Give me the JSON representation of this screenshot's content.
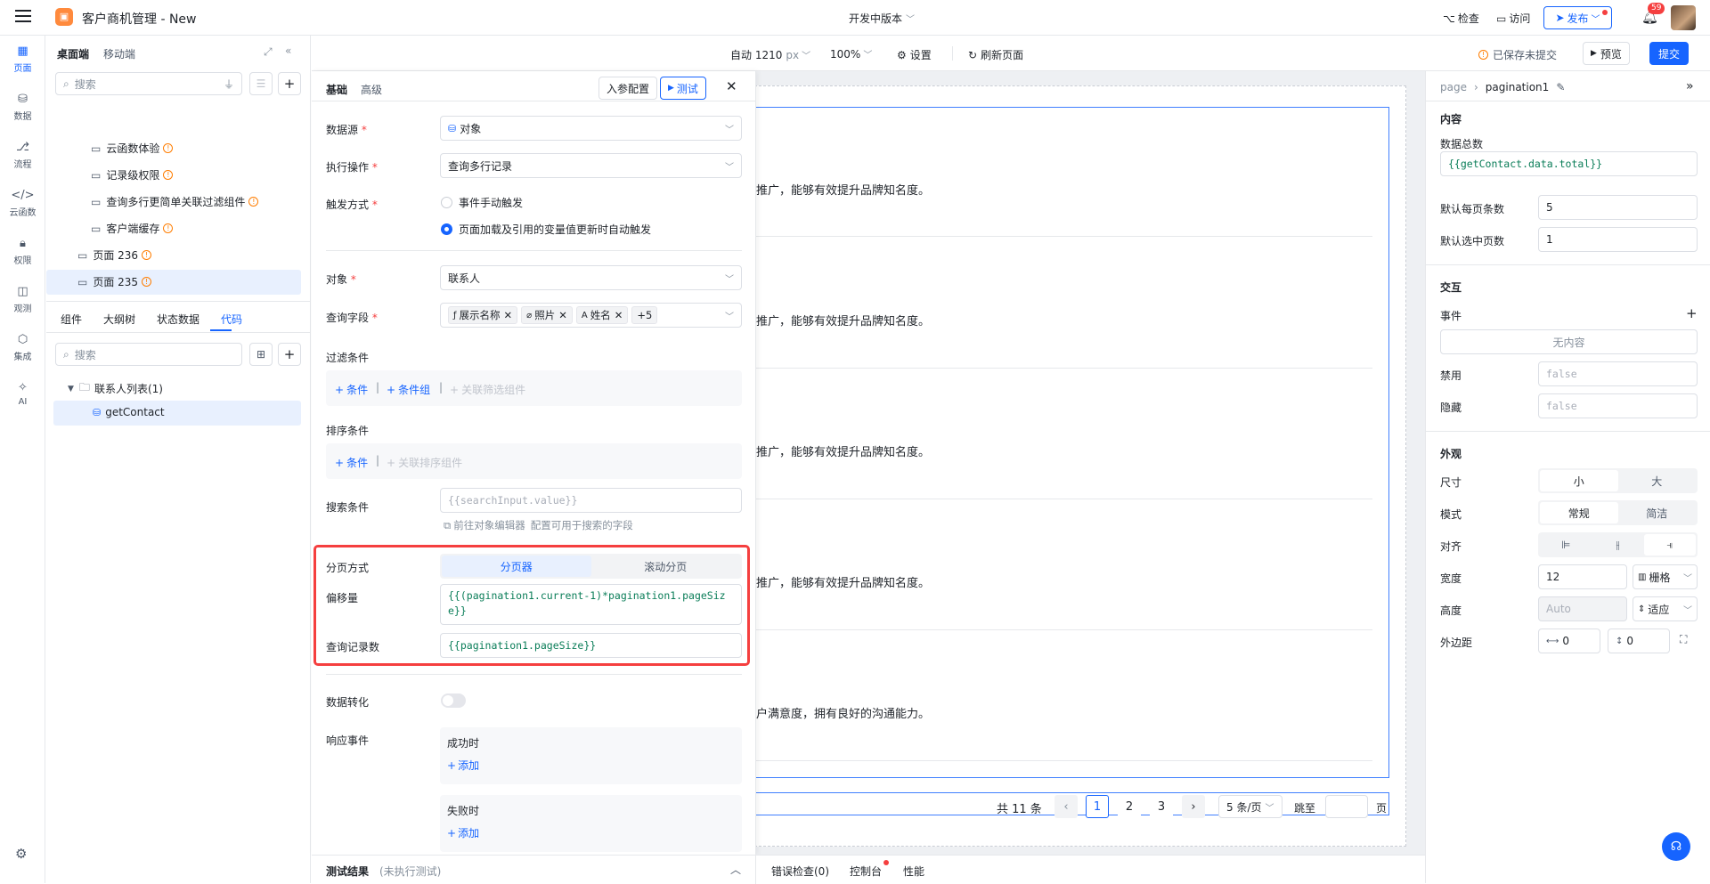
{
  "app": {
    "title": "客户商机管理 - New",
    "version": "开发中版本",
    "check": "检查",
    "visit": "访问",
    "publish": "发布",
    "notification_count": "59"
  },
  "rail": [
    {
      "label": "页面",
      "icon": "page-icon"
    },
    {
      "label": "数据",
      "icon": "database-icon"
    },
    {
      "label": "流程",
      "icon": "flow-icon"
    },
    {
      "label": "云函数",
      "icon": "code-icon"
    },
    {
      "label": "权限",
      "icon": "lock-icon"
    },
    {
      "label": "观测",
      "icon": "monitor-icon"
    },
    {
      "label": "集成",
      "icon": "integration-icon"
    },
    {
      "label": "AI",
      "icon": "ai-icon"
    }
  ],
  "tree": {
    "tabs": [
      "桌面端",
      "移动端"
    ],
    "search_placeholder": "搜索",
    "pages": [
      "云函数体验",
      "记录级权限",
      "查询多行更简单关联过滤组件",
      "客户端缓存",
      "页面 236",
      "页面 235"
    ],
    "bottom_tabs": [
      "组件",
      "大纲树",
      "状态数据",
      "代码"
    ],
    "code_search_placeholder": "搜索",
    "folder": "联系人列表(1)",
    "item": "getContact"
  },
  "toolbar": {
    "auto": "自动 1210",
    "px": "px",
    "zoom": "100%",
    "settings": "设置",
    "refresh": "刷新页面",
    "saved": "已保存未提交",
    "preview": "预览",
    "submit": "提交"
  },
  "query": {
    "tabs": [
      "基础",
      "高级"
    ],
    "param_config": "入参配置",
    "test": "测试",
    "datasource_label": "数据源",
    "datasource_value": "对象",
    "action_label": "执行操作",
    "action_value": "查询多行记录",
    "trigger_label": "触发方式",
    "trigger_opt1": "事件手动触发",
    "trigger_opt2": "页面加载及引用的变量值更新时自动触发",
    "object_label": "对象",
    "object_value": "联系人",
    "fields_label": "查询字段",
    "fields": [
      "展示名称",
      "照片",
      "姓名"
    ],
    "fields_more": "+5",
    "filter_label": "过滤条件",
    "add_condition": "条件",
    "add_group": "条件组",
    "link_filter": "关联筛选组件",
    "sort_label": "排序条件",
    "link_sort": "关联排序组件",
    "search_label": "搜索条件",
    "search_value": "{{searchInput.value}}",
    "goto_editor": "前往对象编辑器",
    "goto_hint": "配置可用于搜索的字段",
    "paging_label": "分页方式",
    "paging_opts": [
      "分页器",
      "滚动分页"
    ],
    "offset_label": "偏移量",
    "offset_value": "{{(pagination1.current-1)*pagination1.pageSize}}",
    "limit_label": "查询记录数",
    "limit_value": "{{pagination1.pageSize}}",
    "transform_label": "数据转化",
    "events_label": "响应事件",
    "on_success": "成功时",
    "on_fail": "失败时",
    "add": "添加",
    "result_label": "测试结果",
    "result_status": "(未执行测试)"
  },
  "canvas": {
    "rows": [
      "推广，能够有效提升品牌知名度。",
      "推广，能够有效提升品牌知名度。",
      "推广，能够有效提升品牌知名度。",
      "推广，能够有效提升品牌知名度。",
      "户满意度，拥有良好的沟通能力。"
    ],
    "total": "共 11 条",
    "pages": [
      "1",
      "2",
      "3"
    ],
    "page_size": "5 条/页",
    "jump": "跳至",
    "page_unit": "页"
  },
  "bottom": {
    "errors": "错误检查(0)",
    "console": "控制台",
    "perf": "性能"
  },
  "props": {
    "breadcrumb_root": "page",
    "breadcrumb_item": "pagination1",
    "content_title": "内容",
    "total_label": "数据总数",
    "total_value": "{{getContact.data.total}}",
    "page_size_label": "默认每页条数",
    "page_size_value": "5",
    "current_label": "默认选中页数",
    "current_value": "1",
    "interaction_title": "交互",
    "events_label": "事件",
    "events_empty": "无内容",
    "disabled_label": "禁用",
    "disabled_value": "false",
    "hidden_label": "隐藏",
    "hidden_value": "false",
    "appearance_title": "外观",
    "size_label": "尺寸",
    "size_opts": [
      "小",
      "大"
    ],
    "mode_label": "模式",
    "mode_opts": [
      "常规",
      "简洁"
    ],
    "align_label": "对齐",
    "width_label": "宽度",
    "width_value": "12",
    "width_unit": "栅格",
    "height_label": "高度",
    "height_placeholder": "Auto",
    "height_unit": "适应",
    "margin_label": "外边距",
    "margin_x": "0",
    "margin_y": "0"
  },
  "colors": {
    "accent": "#1664ff",
    "highlight_border": "#f53f3f",
    "warn": "#ff7d00",
    "selected_bg": "#e8f0fe"
  }
}
